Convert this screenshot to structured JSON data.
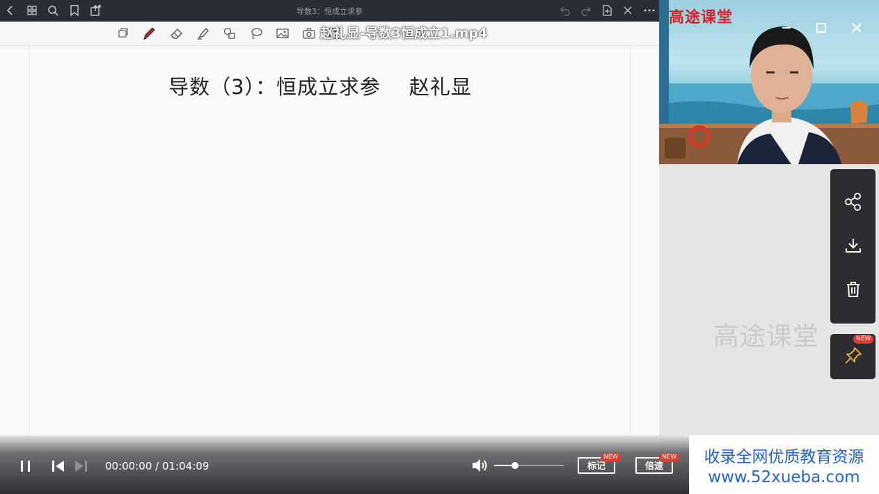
{
  "top_bar": {
    "doc_title": "导数3：恒成立求参",
    "left_icons": [
      "back-icon",
      "grid-icon",
      "search-icon",
      "bookmark-icon",
      "share-icon"
    ],
    "right_icons": [
      "undo-icon",
      "redo-icon",
      "add-page-icon",
      "close-icon",
      "more-icon"
    ]
  },
  "toolbar": {
    "tools": [
      "select-icon",
      "pen-icon",
      "eraser-icon",
      "highlighter-icon",
      "shapes-icon",
      "lasso-icon",
      "image-icon",
      "camera-icon",
      "text-icon"
    ]
  },
  "video": {
    "file_title": "赵礼显-导数3恒成立1.mp4",
    "current_time": "00:00:00",
    "separator": "/",
    "total_time": "01:04:09",
    "volume_level": 0.3,
    "mark_label": "标记",
    "speed_label": "倍速",
    "new_badge": "NEW"
  },
  "canvas": {
    "heading": "导数（3）：恒成立求参    赵礼显"
  },
  "camera": {
    "brand": "高途课堂"
  },
  "side_panel": {
    "watermark_brand": "高途课堂",
    "actions": [
      "share-icon",
      "download-icon",
      "delete-icon"
    ],
    "pin_badge": "NEW"
  },
  "banner": {
    "line1": "收录全网优质教育资源",
    "line2": "www.52xueba.com"
  },
  "colors": {
    "accent_red": "#d3232b",
    "badge_red": "#e23a2f",
    "banner_blue": "#2563c8",
    "topbar": "#2b2d36"
  }
}
